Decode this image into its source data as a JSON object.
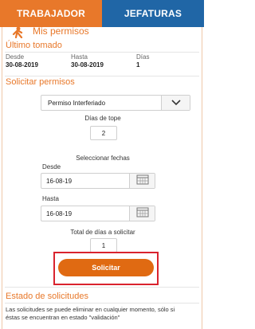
{
  "tabs": {
    "trabajador": "TRABAJADOR",
    "jefaturas": "JEFATURAS"
  },
  "header": {
    "title": "Mis permisos",
    "icon": "person-walking-icon"
  },
  "ultimo_tomado": {
    "title": "Último tomado",
    "desde_label": "Desde",
    "desde_value": "30-08-2019",
    "hasta_label": "Hasta",
    "hasta_value": "30-08-2019",
    "dias_label": "Días",
    "dias_value": "1"
  },
  "solicitar": {
    "title": "Solicitar permisos",
    "tipo_value": "Permiso Interferiado",
    "dias_tope_label": "Días de tope",
    "dias_tope_value": "2",
    "seleccionar_label": "Seleccionar fechas",
    "desde_label": "Desde",
    "desde_value": "16-08-19",
    "hasta_label": "Hasta",
    "hasta_value": "16-08-19",
    "total_label": "Total de días a solicitar",
    "total_value": "1",
    "submit_label": "Solicitar"
  },
  "estado": {
    "title": "Estado de solicitudes",
    "line1": "Las solicitudes se puede eliminar en cualquier momento, sólo si",
    "line2": "éstas se encuentran en estado \"validación\""
  },
  "colors": {
    "accent": "#e8782a",
    "tab_blue": "#2066a6",
    "button": "#e06a12",
    "highlight_border": "#d9232e"
  }
}
